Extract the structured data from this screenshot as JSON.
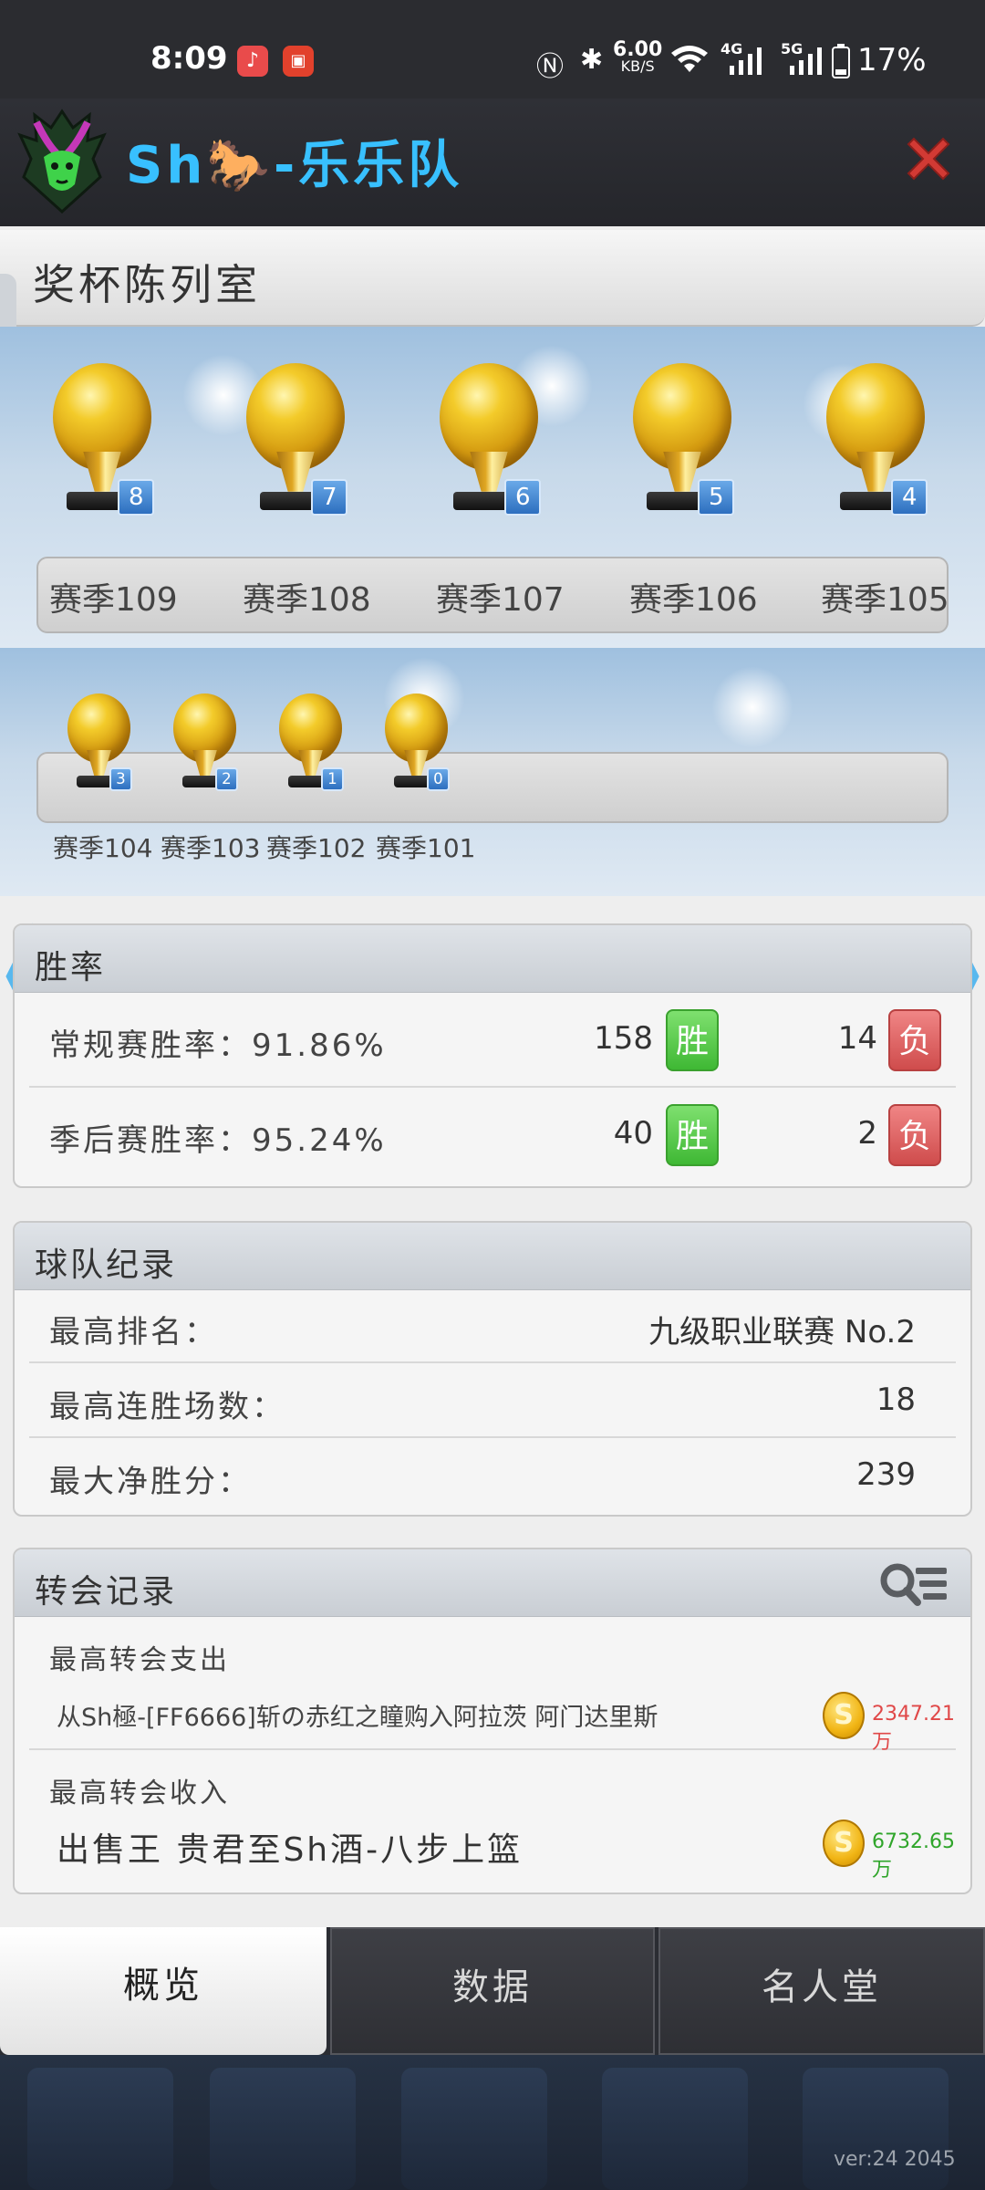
{
  "status_bar": {
    "time": "8:09",
    "speed": "6.00",
    "speed_unit": "KB/S",
    "network_4g": "4G",
    "network_5g": "5G",
    "battery": "17%"
  },
  "header": {
    "team_name_prefix": "Sh",
    "team_name_suffix": "-乐乐队"
  },
  "trophy_room": {
    "title": "奖杯陈列室",
    "row1": [
      {
        "season": "赛季109",
        "count": "8"
      },
      {
        "season": "赛季108",
        "count": "7"
      },
      {
        "season": "赛季107",
        "count": "6"
      },
      {
        "season": "赛季106",
        "count": "5"
      },
      {
        "season": "赛季105",
        "count": "4"
      }
    ],
    "row2": [
      {
        "season": "赛季104",
        "count": "3"
      },
      {
        "season": "赛季103",
        "count": "2"
      },
      {
        "season": "赛季102",
        "count": "1"
      },
      {
        "season": "赛季101",
        "count": "0"
      }
    ]
  },
  "win_rate": {
    "title": "胜率",
    "regular": {
      "label": "常规赛胜率：91.86%",
      "wins": "158",
      "win_tag": "胜",
      "losses": "14",
      "loss_tag": "负"
    },
    "playoff": {
      "label": "季后赛胜率：95.24%",
      "wins": "40",
      "win_tag": "胜",
      "losses": "2",
      "loss_tag": "负"
    }
  },
  "team_record": {
    "title": "球队纪录",
    "rows": [
      {
        "label": "最高排名：",
        "value": "九级职业联赛 No.2"
      },
      {
        "label": "最高连胜场数：",
        "value": "18"
      },
      {
        "label": "最大净胜分：",
        "value": "239"
      }
    ]
  },
  "transfer_record": {
    "title": "转会记录",
    "spend_label": "最高转会支出",
    "spend_text": "从Sh極-[FF6666]斩の赤红之瞳购入阿拉茨 阿门达里斯",
    "spend_amount": "2347.21万",
    "income_label": "最高转会收入",
    "income_text": "出售王 贵君至Sh酒-八步上篮",
    "income_amount": "6732.65万",
    "coin_symbol": "S"
  },
  "tabs": {
    "overview": "概览",
    "data": "数据",
    "hall_of_fame": "名人堂"
  },
  "version": "ver:24  2045",
  "colors": {
    "accent_blue": "#38c0ff",
    "win_green": "#3fb834",
    "loss_red": "#cf4c4c",
    "spend_red": "#e04848",
    "income_green": "#2fa52a"
  }
}
